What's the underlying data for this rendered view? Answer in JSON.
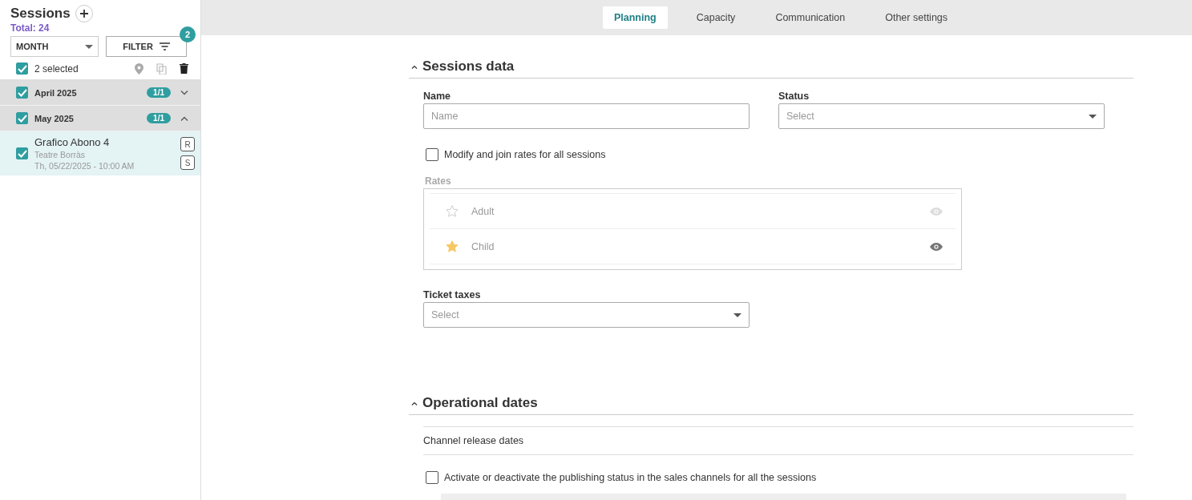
{
  "sidebar": {
    "title": "Sessions",
    "total": "Total: 24",
    "view_select": {
      "value": "MONTH"
    },
    "filter": {
      "label": "FILTER",
      "badge": "2"
    },
    "selection": {
      "checked": true,
      "label": "2 selected"
    },
    "groups": [
      {
        "label": "April 2025",
        "checked": true,
        "count": "1/1",
        "expanded": false
      },
      {
        "label": "May 2025",
        "checked": true,
        "count": "1/1",
        "expanded": true,
        "children": [
          {
            "name": "Grafico Abono 4",
            "venue": "Teatre Borràs",
            "date": "Th, 05/22/2025 - 10:00 AM",
            "checked": true,
            "selected": true,
            "tags": [
              "R",
              "S"
            ]
          }
        ]
      }
    ]
  },
  "tabs": [
    {
      "label": "Planning",
      "selected": true
    },
    {
      "label": "Capacity",
      "selected": false
    },
    {
      "label": "Communication",
      "selected": false
    },
    {
      "label": "Other settings",
      "selected": false
    }
  ],
  "sessions_data": {
    "title": "Sessions data",
    "expanded": true,
    "name_field": {
      "label": "Name",
      "placeholder": "Name"
    },
    "status_field": {
      "label": "Status",
      "placeholder": "Select"
    },
    "modify_rates": {
      "label": "Modify and join rates for all sessions",
      "checked": false
    },
    "rates": {
      "label": "Rates",
      "disabled": true,
      "items": [
        {
          "name": "Adult",
          "default": false,
          "visible": false
        },
        {
          "name": "Child",
          "default": true,
          "visible": true
        }
      ]
    },
    "ticket_taxes": {
      "label": "Ticket taxes",
      "placeholder": "Select"
    }
  },
  "operational_dates": {
    "title": "Operational dates",
    "expanded": true,
    "subtitle": "Channel release dates",
    "publishing": {
      "label": "Activate or deactivate the publishing status in the sales channels for all the sessions",
      "checked": false
    }
  }
}
